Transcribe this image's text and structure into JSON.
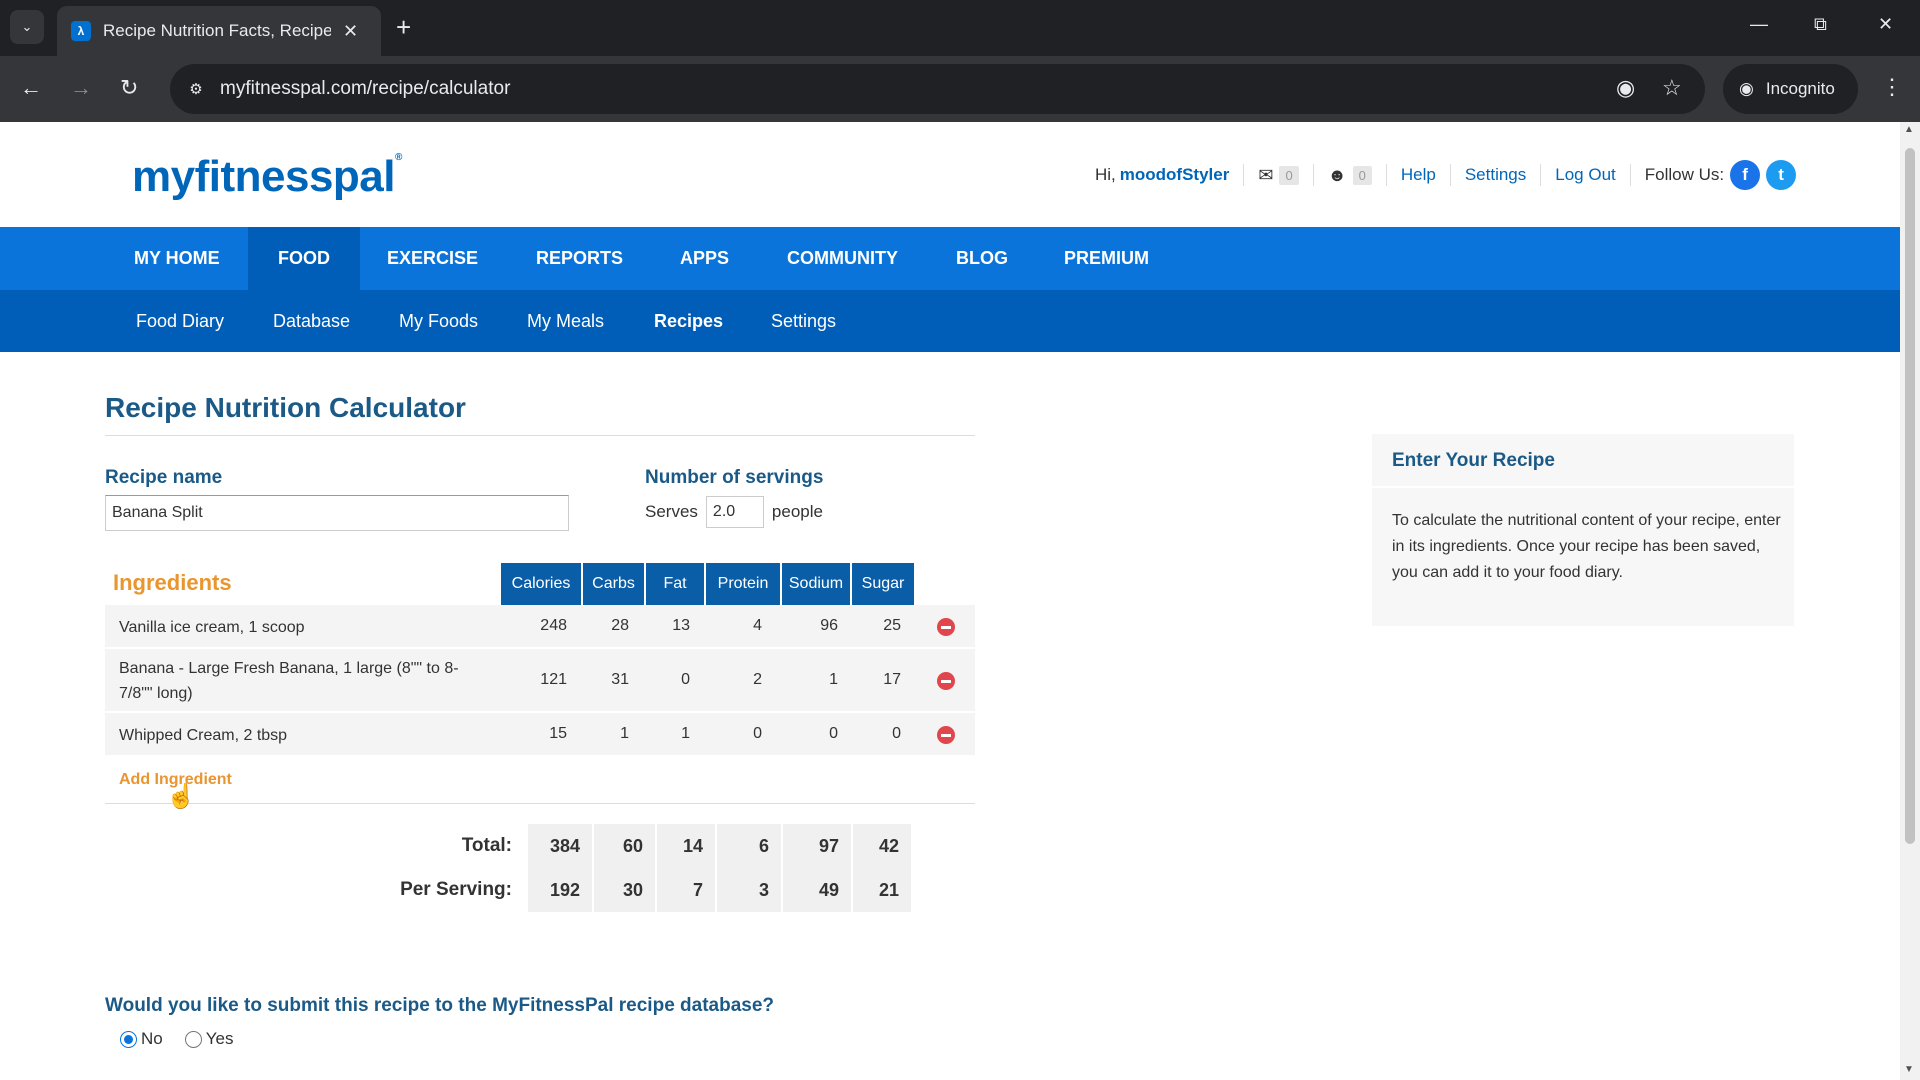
{
  "browser": {
    "tab_title": "Recipe Nutrition Facts, Recipe N",
    "url": "myfitnesspal.com/recipe/calculator",
    "incognito_label": "Incognito"
  },
  "site": {
    "logo": "myfitnesspal",
    "greeting": "Hi,",
    "username": "moodofStyler",
    "messages_count": "0",
    "friends_count": "0",
    "links": [
      "Help",
      "Settings",
      "Log Out"
    ],
    "follow_us": "Follow Us:"
  },
  "mainnav": [
    "MY HOME",
    "FOOD",
    "EXERCISE",
    "REPORTS",
    "APPS",
    "COMMUNITY",
    "BLOG",
    "PREMIUM"
  ],
  "subnav": [
    "Food Diary",
    "Database",
    "My Foods",
    "My Meals",
    "Recipes",
    "Settings"
  ],
  "calculator": {
    "title": "Recipe Nutrition Calculator",
    "recipe_name_label": "Recipe name",
    "recipe_name_value": "Banana Split",
    "servings_label": "Number of servings",
    "serves_prefix": "Serves",
    "servings_value": "2.0",
    "serves_suffix": "people",
    "ingredients_heading": "Ingredients",
    "columns": [
      "Calories",
      "Carbs",
      "Fat",
      "Protein",
      "Sodium",
      "Sugar"
    ],
    "ingredients": [
      {
        "name": "Vanilla ice cream, 1 scoop",
        "values": [
          "248",
          "28",
          "13",
          "4",
          "96",
          "25"
        ]
      },
      {
        "name": "Banana - Large Fresh Banana, 1 large (8\"\" to 8-7/8\"\" long)",
        "values": [
          "121",
          "31",
          "0",
          "2",
          "1",
          "17"
        ]
      },
      {
        "name": "Whipped Cream, 2 tbsp",
        "values": [
          "15",
          "1",
          "1",
          "0",
          "0",
          "0"
        ]
      }
    ],
    "add_ingredient": "Add Ingredient",
    "total_label": "Total:",
    "total": [
      "384",
      "60",
      "14",
      "6",
      "97",
      "42"
    ],
    "per_serving_label": "Per Serving:",
    "per_serving": [
      "192",
      "30",
      "7",
      "3",
      "49",
      "21"
    ],
    "submit_question": "Would you like to submit this recipe to the MyFitnessPal recipe database?",
    "radio_no": "No",
    "radio_yes": "Yes"
  },
  "sidebar": {
    "title": "Enter Your Recipe",
    "text": "To calculate the nutritional content of your recipe, enter in its ingredients. Once your recipe has been saved, you can add it to your food diary."
  },
  "colors": {
    "nav_blue": "#0a74da",
    "subnav_blue": "#005eb8",
    "heading_blue": "#1b5a87",
    "accent_orange": "#e99530"
  }
}
